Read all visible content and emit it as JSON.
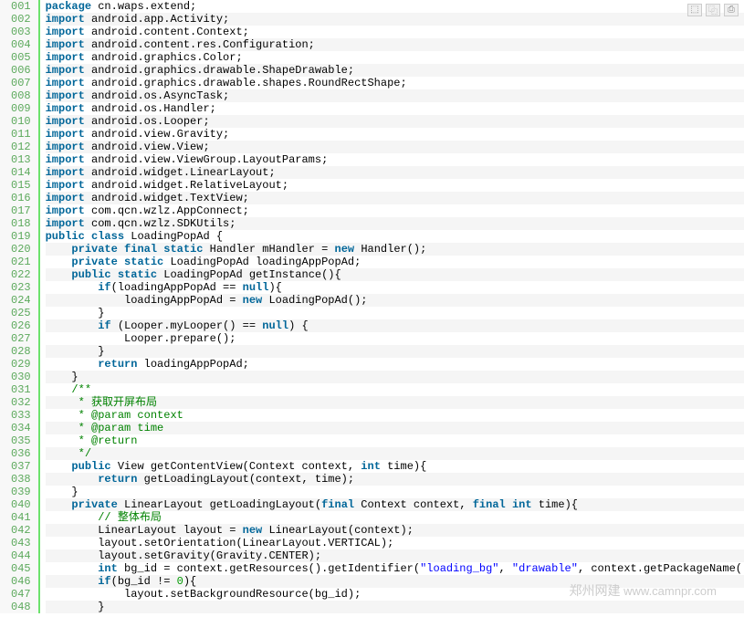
{
  "toolbar": {
    "icon1": "⬚",
    "icon2": "⿻",
    "icon3": "⎙"
  },
  "watermark": {
    "zh": "郑州网建",
    "en": " www.camnpr.com"
  },
  "lines": [
    {
      "n": "001",
      "seg": [
        {
          "c": "kw",
          "t": "package"
        },
        {
          "c": "pln",
          "t": " cn.waps.extend;"
        }
      ]
    },
    {
      "n": "002",
      "seg": [
        {
          "c": "kw",
          "t": "import"
        },
        {
          "c": "pln",
          "t": " android.app.Activity;"
        }
      ]
    },
    {
      "n": "003",
      "seg": [
        {
          "c": "kw",
          "t": "import"
        },
        {
          "c": "pln",
          "t": " android.content.Context;"
        }
      ]
    },
    {
      "n": "004",
      "seg": [
        {
          "c": "kw",
          "t": "import"
        },
        {
          "c": "pln",
          "t": " android.content.res.Configuration;"
        }
      ]
    },
    {
      "n": "005",
      "seg": [
        {
          "c": "kw",
          "t": "import"
        },
        {
          "c": "pln",
          "t": " android.graphics.Color;"
        }
      ]
    },
    {
      "n": "006",
      "seg": [
        {
          "c": "kw",
          "t": "import"
        },
        {
          "c": "pln",
          "t": " android.graphics.drawable.ShapeDrawable;"
        }
      ]
    },
    {
      "n": "007",
      "seg": [
        {
          "c": "kw",
          "t": "import"
        },
        {
          "c": "pln",
          "t": " android.graphics.drawable.shapes.RoundRectShape;"
        }
      ]
    },
    {
      "n": "008",
      "seg": [
        {
          "c": "kw",
          "t": "import"
        },
        {
          "c": "pln",
          "t": " android.os.AsyncTask;"
        }
      ]
    },
    {
      "n": "009",
      "seg": [
        {
          "c": "kw",
          "t": "import"
        },
        {
          "c": "pln",
          "t": " android.os.Handler;"
        }
      ]
    },
    {
      "n": "010",
      "seg": [
        {
          "c": "kw",
          "t": "import"
        },
        {
          "c": "pln",
          "t": " android.os.Looper;"
        }
      ]
    },
    {
      "n": "011",
      "seg": [
        {
          "c": "kw",
          "t": "import"
        },
        {
          "c": "pln",
          "t": " android.view.Gravity;"
        }
      ]
    },
    {
      "n": "012",
      "seg": [
        {
          "c": "kw",
          "t": "import"
        },
        {
          "c": "pln",
          "t": " android.view.View;"
        }
      ]
    },
    {
      "n": "013",
      "seg": [
        {
          "c": "kw",
          "t": "import"
        },
        {
          "c": "pln",
          "t": " android.view.ViewGroup.LayoutParams;"
        }
      ]
    },
    {
      "n": "014",
      "seg": [
        {
          "c": "kw",
          "t": "import"
        },
        {
          "c": "pln",
          "t": " android.widget.LinearLayout;"
        }
      ]
    },
    {
      "n": "015",
      "seg": [
        {
          "c": "kw",
          "t": "import"
        },
        {
          "c": "pln",
          "t": " android.widget.RelativeLayout;"
        }
      ]
    },
    {
      "n": "016",
      "seg": [
        {
          "c": "kw",
          "t": "import"
        },
        {
          "c": "pln",
          "t": " android.widget.TextView;"
        }
      ]
    },
    {
      "n": "017",
      "seg": [
        {
          "c": "kw",
          "t": "import"
        },
        {
          "c": "pln",
          "t": " com.qcn.wzlz.AppConnect;"
        }
      ]
    },
    {
      "n": "018",
      "seg": [
        {
          "c": "kw",
          "t": "import"
        },
        {
          "c": "pln",
          "t": " com.qcn.wzlz.SDKUtils;"
        }
      ]
    },
    {
      "n": "019",
      "seg": [
        {
          "c": "kw",
          "t": "public"
        },
        {
          "c": "pln",
          "t": " "
        },
        {
          "c": "kw",
          "t": "class"
        },
        {
          "c": "pln",
          "t": " LoadingPopAd {"
        }
      ]
    },
    {
      "n": "020",
      "seg": [
        {
          "c": "pln",
          "t": "    "
        },
        {
          "c": "kw",
          "t": "private"
        },
        {
          "c": "pln",
          "t": " "
        },
        {
          "c": "kw",
          "t": "final"
        },
        {
          "c": "pln",
          "t": " "
        },
        {
          "c": "kw",
          "t": "static"
        },
        {
          "c": "pln",
          "t": " Handler mHandler = "
        },
        {
          "c": "kw",
          "t": "new"
        },
        {
          "c": "pln",
          "t": " Handler();"
        }
      ]
    },
    {
      "n": "021",
      "seg": [
        {
          "c": "pln",
          "t": "    "
        },
        {
          "c": "kw",
          "t": "private"
        },
        {
          "c": "pln",
          "t": " "
        },
        {
          "c": "kw",
          "t": "static"
        },
        {
          "c": "pln",
          "t": " LoadingPopAd loadingAppPopAd;"
        }
      ]
    },
    {
      "n": "022",
      "seg": [
        {
          "c": "pln",
          "t": "    "
        },
        {
          "c": "kw",
          "t": "public"
        },
        {
          "c": "pln",
          "t": " "
        },
        {
          "c": "kw",
          "t": "static"
        },
        {
          "c": "pln",
          "t": " LoadingPopAd getInstance(){"
        }
      ]
    },
    {
      "n": "023",
      "seg": [
        {
          "c": "pln",
          "t": "        "
        },
        {
          "c": "kw",
          "t": "if"
        },
        {
          "c": "pln",
          "t": "(loadingAppPopAd == "
        },
        {
          "c": "kw",
          "t": "null"
        },
        {
          "c": "pln",
          "t": "){"
        }
      ]
    },
    {
      "n": "024",
      "seg": [
        {
          "c": "pln",
          "t": "            loadingAppPopAd = "
        },
        {
          "c": "kw",
          "t": "new"
        },
        {
          "c": "pln",
          "t": " LoadingPopAd();"
        }
      ]
    },
    {
      "n": "025",
      "seg": [
        {
          "c": "pln",
          "t": "        }"
        }
      ]
    },
    {
      "n": "026",
      "seg": [
        {
          "c": "pln",
          "t": "        "
        },
        {
          "c": "kw",
          "t": "if"
        },
        {
          "c": "pln",
          "t": " (Looper.myLooper() == "
        },
        {
          "c": "kw",
          "t": "null"
        },
        {
          "c": "pln",
          "t": ") {"
        }
      ]
    },
    {
      "n": "027",
      "seg": [
        {
          "c": "pln",
          "t": "            Looper.prepare();"
        }
      ]
    },
    {
      "n": "028",
      "seg": [
        {
          "c": "pln",
          "t": "        }"
        }
      ]
    },
    {
      "n": "029",
      "seg": [
        {
          "c": "pln",
          "t": "        "
        },
        {
          "c": "kw",
          "t": "return"
        },
        {
          "c": "pln",
          "t": " loadingAppPopAd;"
        }
      ]
    },
    {
      "n": "030",
      "seg": [
        {
          "c": "pln",
          "t": "    }"
        }
      ]
    },
    {
      "n": "031",
      "seg": [
        {
          "c": "pln",
          "t": "    "
        },
        {
          "c": "cmt",
          "t": "/**"
        }
      ]
    },
    {
      "n": "032",
      "seg": [
        {
          "c": "pln",
          "t": "     "
        },
        {
          "c": "cmt",
          "t": "* 获取开屏布局"
        }
      ]
    },
    {
      "n": "033",
      "seg": [
        {
          "c": "pln",
          "t": "     "
        },
        {
          "c": "cmt",
          "t": "* @param context"
        }
      ]
    },
    {
      "n": "034",
      "seg": [
        {
          "c": "pln",
          "t": "     "
        },
        {
          "c": "cmt",
          "t": "* @param time"
        }
      ]
    },
    {
      "n": "035",
      "seg": [
        {
          "c": "pln",
          "t": "     "
        },
        {
          "c": "cmt",
          "t": "* @return"
        }
      ]
    },
    {
      "n": "036",
      "seg": [
        {
          "c": "pln",
          "t": "     "
        },
        {
          "c": "cmt",
          "t": "*/"
        }
      ]
    },
    {
      "n": "037",
      "seg": [
        {
          "c": "pln",
          "t": "    "
        },
        {
          "c": "kw",
          "t": "public"
        },
        {
          "c": "pln",
          "t": " View getContentView(Context context, "
        },
        {
          "c": "kw",
          "t": "int"
        },
        {
          "c": "pln",
          "t": " time){"
        }
      ]
    },
    {
      "n": "038",
      "seg": [
        {
          "c": "pln",
          "t": "        "
        },
        {
          "c": "kw",
          "t": "return"
        },
        {
          "c": "pln",
          "t": " getLoadingLayout(context, time);"
        }
      ]
    },
    {
      "n": "039",
      "seg": [
        {
          "c": "pln",
          "t": "    }"
        }
      ]
    },
    {
      "n": "040",
      "seg": [
        {
          "c": "pln",
          "t": "    "
        },
        {
          "c": "kw",
          "t": "private"
        },
        {
          "c": "pln",
          "t": " LinearLayout getLoadingLayout("
        },
        {
          "c": "kw",
          "t": "final"
        },
        {
          "c": "pln",
          "t": " Context context, "
        },
        {
          "c": "kw",
          "t": "final"
        },
        {
          "c": "pln",
          "t": " "
        },
        {
          "c": "kw",
          "t": "int"
        },
        {
          "c": "pln",
          "t": " time){"
        }
      ]
    },
    {
      "n": "041",
      "seg": [
        {
          "c": "pln",
          "t": "        "
        },
        {
          "c": "cmt",
          "t": "// 整体布局"
        }
      ]
    },
    {
      "n": "042",
      "seg": [
        {
          "c": "pln",
          "t": "        LinearLayout layout = "
        },
        {
          "c": "kw",
          "t": "new"
        },
        {
          "c": "pln",
          "t": " LinearLayout(context);"
        }
      ]
    },
    {
      "n": "043",
      "seg": [
        {
          "c": "pln",
          "t": "        layout.setOrientation(LinearLayout.VERTICAL);"
        }
      ]
    },
    {
      "n": "044",
      "seg": [
        {
          "c": "pln",
          "t": "        layout.setGravity(Gravity.CENTER);"
        }
      ]
    },
    {
      "n": "045",
      "seg": [
        {
          "c": "pln",
          "t": "        "
        },
        {
          "c": "kw",
          "t": "int"
        },
        {
          "c": "pln",
          "t": " bg_id = context.getResources().getIdentifier("
        },
        {
          "c": "str",
          "t": "\"loading_bg\""
        },
        {
          "c": "pln",
          "t": ", "
        },
        {
          "c": "str",
          "t": "\"drawable\""
        },
        {
          "c": "pln",
          "t": ", context.getPackageName());"
        }
      ]
    },
    {
      "n": "046",
      "seg": [
        {
          "c": "pln",
          "t": "        "
        },
        {
          "c": "kw",
          "t": "if"
        },
        {
          "c": "pln",
          "t": "(bg_id != "
        },
        {
          "c": "num",
          "t": "0"
        },
        {
          "c": "pln",
          "t": "){"
        }
      ]
    },
    {
      "n": "047",
      "seg": [
        {
          "c": "pln",
          "t": "            layout.setBackgroundResource(bg_id);"
        }
      ]
    },
    {
      "n": "048",
      "seg": [
        {
          "c": "pln",
          "t": "        }"
        }
      ]
    }
  ]
}
